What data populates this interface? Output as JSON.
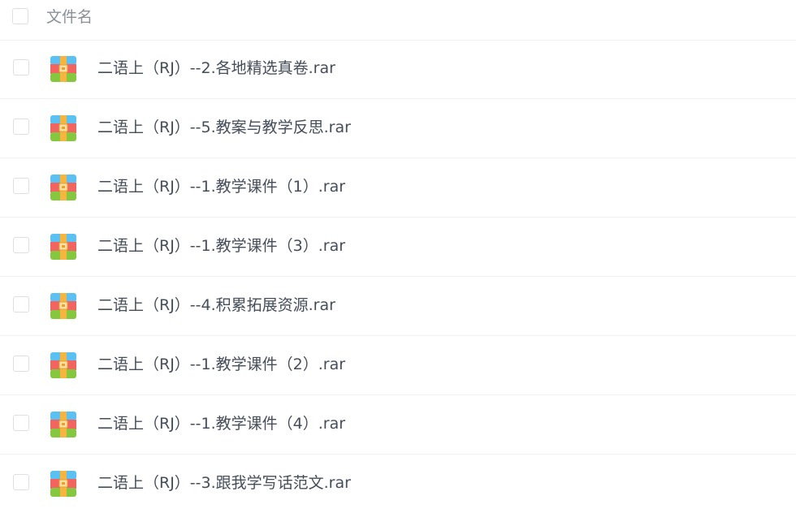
{
  "header": {
    "filename_label": "文件名"
  },
  "files": [
    {
      "name": "二语上（RJ）--2.各地精选真卷.rar",
      "icon": "rar-archive-icon"
    },
    {
      "name": "二语上（RJ）--5.教案与教学反思.rar",
      "icon": "rar-archive-icon"
    },
    {
      "name": "二语上（RJ）--1.教学课件（1）.rar",
      "icon": "rar-archive-icon"
    },
    {
      "name": "二语上（RJ）--1.教学课件（3）.rar",
      "icon": "rar-archive-icon"
    },
    {
      "name": "二语上（RJ）--4.积累拓展资源.rar",
      "icon": "rar-archive-icon"
    },
    {
      "name": "二语上（RJ）--1.教学课件（2）.rar",
      "icon": "rar-archive-icon"
    },
    {
      "name": "二语上（RJ）--1.教学课件（4）.rar",
      "icon": "rar-archive-icon"
    },
    {
      "name": "二语上（RJ）--3.跟我学写话范文.rar",
      "icon": "rar-archive-icon"
    }
  ],
  "colors": {
    "text_primary": "#454d5a",
    "text_header": "#8a8f99",
    "divider": "#f0f1f3",
    "icon_blue": "#5bc0f2",
    "icon_red": "#f2645f",
    "icon_green": "#85c840",
    "icon_band": "#f5b53f"
  }
}
